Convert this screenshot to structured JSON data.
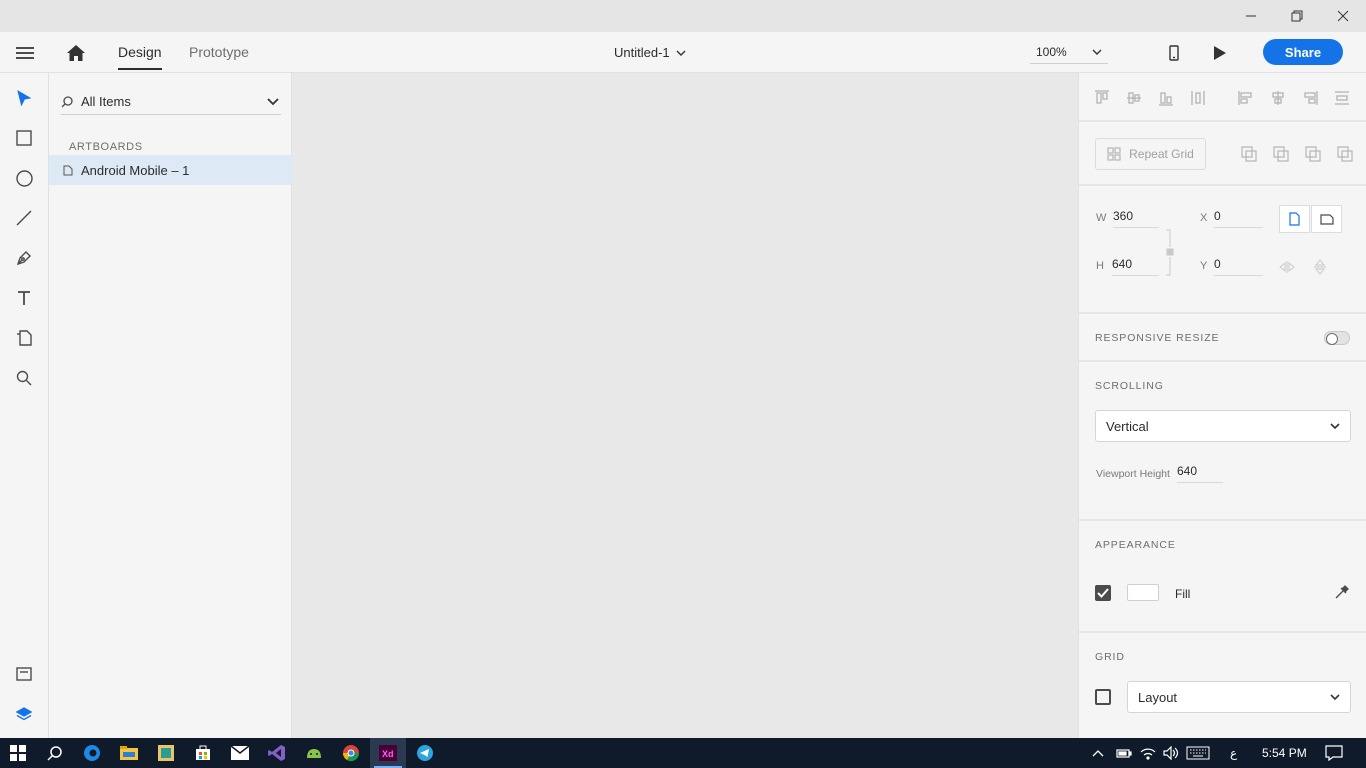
{
  "window": {
    "minimize_icon": "minimize-icon",
    "restore_icon": "restore-icon",
    "close_icon": "close-icon"
  },
  "header": {
    "menu_icon": "hamburger-menu-icon",
    "home_icon": "home-icon",
    "tabs": [
      {
        "label": "Design",
        "active": true
      },
      {
        "label": "Prototype",
        "active": false
      }
    ],
    "document_title": "Untitled-1",
    "zoom": "100%",
    "device_preview_icon": "mobile-device-icon",
    "play_icon": "play-icon",
    "share_label": "Share",
    "accent_color": "#1473e6"
  },
  "tools": [
    {
      "name": "select-tool",
      "icon": "arrow-pointer-icon",
      "active": true
    },
    {
      "name": "rectangle-tool",
      "icon": "rectangle-icon"
    },
    {
      "name": "ellipse-tool",
      "icon": "ellipse-icon"
    },
    {
      "name": "line-tool",
      "icon": "line-icon"
    },
    {
      "name": "pen-tool",
      "icon": "pen-icon"
    },
    {
      "name": "text-tool",
      "icon": "text-icon"
    },
    {
      "name": "artboard-tool",
      "icon": "artboard-icon"
    },
    {
      "name": "zoom-tool",
      "icon": "zoom-icon"
    }
  ],
  "bottom_tools": [
    {
      "name": "assets-panel",
      "icon": "assets-icon"
    },
    {
      "name": "layers-panel",
      "icon": "layers-icon",
      "active": true
    }
  ],
  "layers": {
    "filter_label": "All Items",
    "section_label": "ARTBOARDS",
    "artboards": [
      {
        "name": "Android Mobile – 1",
        "selected": true
      }
    ]
  },
  "properties": {
    "repeat_grid_label": "Repeat Grid",
    "width_label": "W",
    "width": "360",
    "height_label": "H",
    "height": "640",
    "x_label": "X",
    "x": "0",
    "y_label": "Y",
    "y": "0",
    "responsive_resize_label": "RESPONSIVE RESIZE",
    "responsive_resize_on": false,
    "scrolling_label": "SCROLLING",
    "scrolling_value": "Vertical",
    "viewport_height_label": "Viewport Height",
    "viewport_height": "640",
    "appearance_label": "APPEARANCE",
    "fill_label": "Fill",
    "fill_checked": true,
    "fill_color": "#ffffff",
    "grid_label": "GRID",
    "grid_checked": false,
    "grid_type": "Layout"
  },
  "taskbar": {
    "apps": [
      "start-icon",
      "search-icon",
      "edge-icon",
      "file-explorer-icon",
      "app-icon",
      "store-icon",
      "mail-icon",
      "visual-studio-icon",
      "android-studio-icon",
      "chrome-icon",
      "adobe-xd-icon",
      "telegram-icon"
    ],
    "active_app": "adobe-xd-icon",
    "input_language": "ع",
    "time": "5:54 PM"
  }
}
